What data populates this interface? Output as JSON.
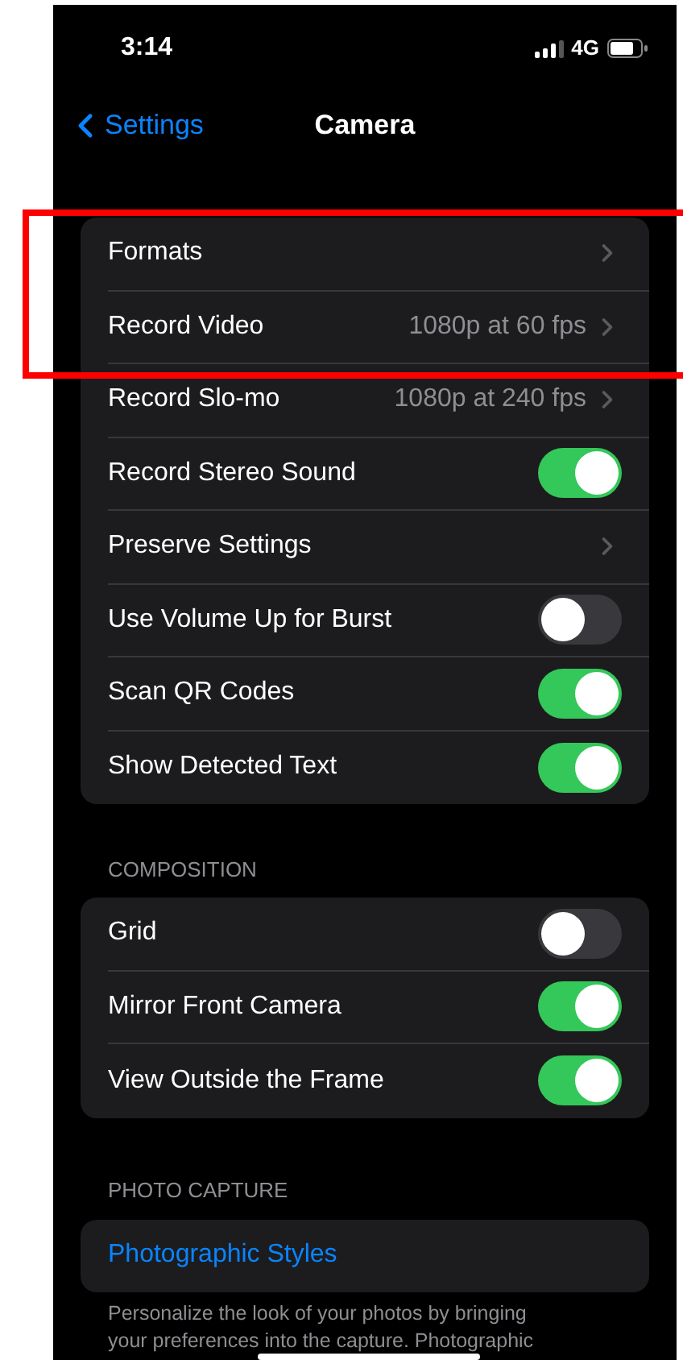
{
  "status_bar": {
    "time": "3:14",
    "network": "4G"
  },
  "nav": {
    "back": "Settings",
    "title": "Camera"
  },
  "groups": [
    {
      "rows": [
        {
          "kind": "chevron",
          "label": "Formats"
        },
        {
          "kind": "chevron",
          "label": "Record Video",
          "value": "1080p at 60 fps"
        },
        {
          "kind": "chevron",
          "label": "Record Slo-mo",
          "value": "1080p at 240 fps"
        },
        {
          "kind": "toggle",
          "label": "Record Stereo Sound",
          "on": true
        },
        {
          "kind": "chevron",
          "label": "Preserve Settings"
        },
        {
          "kind": "toggle",
          "label": "Use Volume Up for Burst",
          "on": false
        },
        {
          "kind": "toggle",
          "label": "Scan QR Codes",
          "on": true
        },
        {
          "kind": "toggle",
          "label": "Show Detected Text",
          "on": true
        }
      ]
    },
    {
      "header": "COMPOSITION",
      "rows": [
        {
          "kind": "toggle",
          "label": "Grid",
          "on": false
        },
        {
          "kind": "toggle",
          "label": "Mirror Front Camera",
          "on": true
        },
        {
          "kind": "toggle",
          "label": "View Outside the Frame",
          "on": true
        }
      ]
    },
    {
      "header": "PHOTO CAPTURE",
      "rows": [
        {
          "kind": "link",
          "label": "Photographic Styles"
        }
      ],
      "footer": [
        "Personalize the look of your photos by bringing",
        "your preferences into the capture. Photographic"
      ]
    }
  ]
}
